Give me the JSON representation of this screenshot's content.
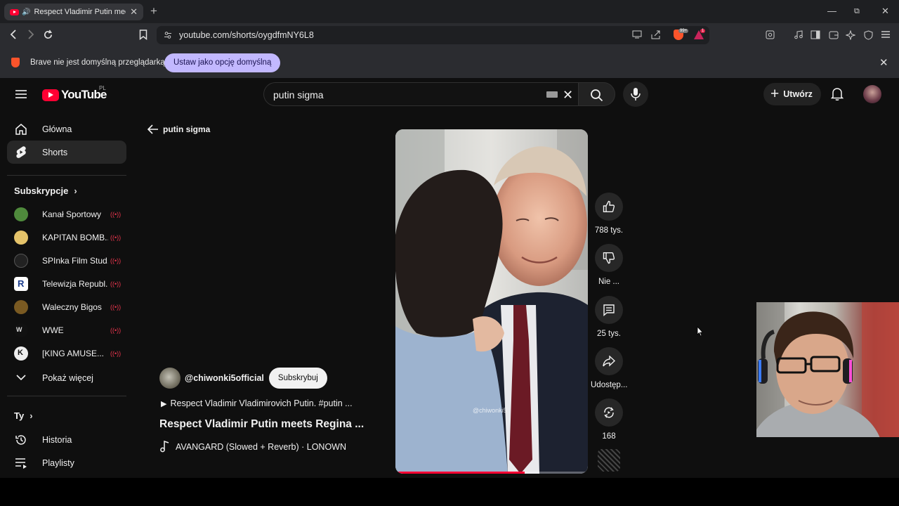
{
  "browser": {
    "tab_title": "Respect Vladimir Putin meets",
    "url": "youtube.com/shorts/oygdfmNY6L8",
    "brave_badge": "99+",
    "rewards_badge": "1",
    "infobar_text": "Brave nie jest domyślną przeglądarką",
    "infobar_button": "Ustaw jako opcję domyślną"
  },
  "masthead": {
    "logo_text": "YouTube",
    "country_code": "PL",
    "search_value": "putin sigma",
    "create_label": "Utwórz"
  },
  "sidebar": {
    "main": [
      {
        "label": "Główna",
        "icon": "home-icon"
      },
      {
        "label": "Shorts",
        "icon": "shorts-icon",
        "active": true
      }
    ],
    "subscriptions_heading": "Subskrypcje",
    "subscriptions": [
      {
        "label": "Kanał Sportowy",
        "color": "#4f8a3c"
      },
      {
        "label": "KAPITAN BOMB...",
        "color": "#e5c36a"
      },
      {
        "label": "SPInka Film Stud...",
        "color": "#222222"
      },
      {
        "label": "Telewizja Republ...",
        "color": "#ffffff"
      },
      {
        "label": "Waleczny Bigos",
        "color": "#7a5a22"
      },
      {
        "label": "WWE",
        "color": "#111111"
      },
      {
        "label": "[KING AMUSE...",
        "color": "#eeeeee"
      }
    ],
    "show_more": "Pokaż więcej",
    "you_heading": "Ty",
    "you_items": [
      {
        "label": "Historia",
        "icon": "history-icon"
      },
      {
        "label": "Playlisty",
        "icon": "playlists-icon"
      }
    ]
  },
  "shorts": {
    "back_label": "putin sigma",
    "channel_handle": "@chiwonki5official",
    "subscribe_label": "Subskrybuj",
    "description": "Respect Vladimir Vladimirovich Putin. #putin ...",
    "title": "Respect Vladimir Putin meets Regina ...",
    "music": "AVANGARD (Slowed + Reverb) · LONOWN",
    "watermark": "@chiwonki5",
    "progress": 0.67,
    "actions": [
      {
        "name": "like",
        "label": "788 tys."
      },
      {
        "name": "dislike",
        "label": "Nie ..."
      },
      {
        "name": "comments",
        "label": "25 tys."
      },
      {
        "name": "share",
        "label": "Udostęp..."
      },
      {
        "name": "remix",
        "label": "168"
      }
    ]
  }
}
